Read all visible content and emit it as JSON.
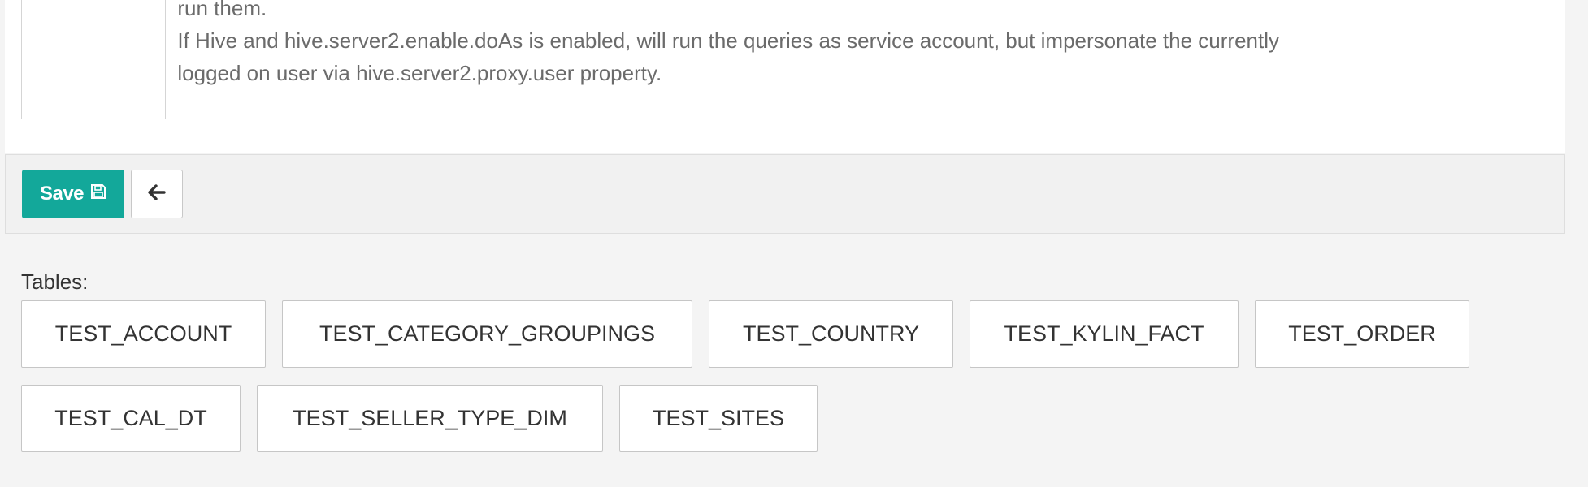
{
  "description": {
    "lines": [
      "run them.",
      "If Hive and hive.server2.enable.doAs is enabled, will run the queries as service account, but impersonate the currently",
      "logged on user via hive.server2.proxy.user property."
    ]
  },
  "toolbar": {
    "save_label": "Save",
    "save_icon": "floppy-disk-icon",
    "back_icon": "arrow-left-icon"
  },
  "tables": {
    "label": "Tables:",
    "items": [
      "TEST_ACCOUNT",
      "TEST_CATEGORY_GROUPINGS",
      "TEST_COUNTRY",
      "TEST_KYLIN_FACT",
      "TEST_ORDER",
      "TEST_CAL_DT",
      "TEST_SELLER_TYPE_DIM",
      "TEST_SITES"
    ]
  },
  "colors": {
    "accent": "#13a89a",
    "background": "#f4f4f4"
  }
}
